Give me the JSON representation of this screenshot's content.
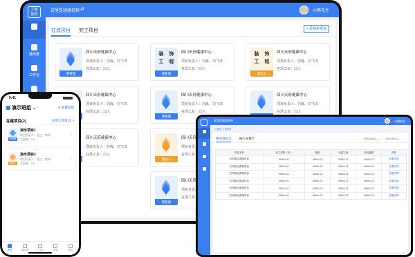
{
  "colors": {
    "primary": "#3a7ef0",
    "accent_orange": "#f0a030",
    "bg": "#f0f2f6"
  },
  "tablet": {
    "logo": "工地\n协同",
    "nav": [
      {
        "icon": "grid-icon",
        "label": ""
      },
      {
        "icon": "contacts-icon",
        "label": "通讯录"
      },
      {
        "icon": "desk-icon",
        "label": "工作台"
      },
      {
        "icon": "message-icon",
        "label": "消息"
      }
    ],
    "team_name": "这里是班组名称",
    "user_name": "小熊先生",
    "tabs": [
      "在建项目",
      "完工项目"
    ],
    "add_button": "+ 添加新项目",
    "cards": [
      {
        "badge": "我管理",
        "title": "四川天府健康中心",
        "manager": "项目负责人：刘胤、刘飞洋",
        "workers": "在场工友：23人",
        "style": "blue",
        "thumb_text": ""
      },
      {
        "badge": "我管理",
        "title": "四川天府健康中心",
        "manager": "项目负责人：刘胤、刘飞洋",
        "workers": "在场工友：23人",
        "style": "plain",
        "thumb_text": "装 饰\n工 程"
      },
      {
        "badge": "我加入",
        "title": "四川天府健康中心",
        "manager": "项目负责人：刘胤、刘飞洋",
        "workers": "在场工友：23人",
        "style": "orange",
        "thumb_text": "装 饰\n工 程"
      },
      {
        "badge": "我管理",
        "title": "四川天府健康中心",
        "manager": "项目负责人：刘胤、刘飞洋",
        "workers": "在场工友：23人",
        "style": "plain",
        "thumb_text": "装 饰\n工 程"
      },
      {
        "badge": "我管理",
        "title": "四川天府健康中心",
        "manager": "项目负责人：刘胤、刘飞洋",
        "workers": "在场工友：23人",
        "style": "blue",
        "thumb_text": ""
      },
      {
        "badge": "我管理",
        "title": "四川天府健康中心",
        "manager": "项目负责人：刘胤、刘飞洋",
        "workers": "在场工友：23人",
        "style": "blue",
        "thumb_text": ""
      },
      {
        "badge": "我管理",
        "title": "四川天府健康中心",
        "manager": "项目负责人：刘胤、刘飞洋",
        "workers": "在场工友：23人",
        "style": "plain",
        "thumb_text": ""
      },
      {
        "badge": "我加入",
        "title": "四川天府健康中心",
        "manager": "项目负责人：刘胤、刘飞洋",
        "workers": "在场工友：23人",
        "style": "orange",
        "thumb_text": ""
      },
      {
        "badge": "我管理",
        "title": "四川天府健康中心",
        "manager": "项目负责人：刘胤、刘飞洋",
        "workers": "在场工友：23人",
        "style": "plain",
        "thumb_text": ""
      },
      {
        "badge": "我管理",
        "title": "四川天府健康中心",
        "manager": "项目负责人：刘胤、刘飞洋",
        "workers": "在场工友：23人",
        "style": "blue",
        "thumb_text": ""
      }
    ]
  },
  "phone": {
    "time": "9:41",
    "team": "演示班组 ⌄",
    "new_team": "⊕ 新建班组",
    "section": "在建项目(2)",
    "switch": "已完工项目(0) >",
    "cards": [
      {
        "title": "演示项目1",
        "manager": "项目负责人：张三、李四",
        "workers": "工友数：5人",
        "badge": "我管理",
        "style": "blue"
      },
      {
        "title": "演示项目2",
        "manager": "项目负责人：张三、李四",
        "workers": "工友数：5人",
        "badge": "我加入",
        "style": "orange"
      }
    ],
    "tabbar": [
      "项目",
      "通讯录",
      "工作台",
      "消息",
      "我的"
    ]
  },
  "laptop": {
    "team_name": "这里是班组名称",
    "user_name": "小熊先生",
    "crumb": "< 返回   工资统计",
    "tabs": [
      "整项目统计",
      "按人员统计"
    ],
    "date_from": "2022-08-01 ⌄",
    "date_sep": "~",
    "date_to": "2022-08-01 ⌄",
    "nav": [
      {
        "icon": "grid-icon"
      },
      {
        "icon": "contacts-icon"
      },
      {
        "icon": "desk-icon"
      },
      {
        "icon": "message-icon"
      }
    ],
    "table": {
      "headers": [
        "项目名称",
        "总工资数（元）",
        "借支",
        "已结工资",
        "未结金额",
        "操作"
      ],
      "rows": [
        [
          "天府新区健康项目",
          "98664.32",
          "98664.32",
          "98664.32",
          "98664.32",
          "查看详情"
        ],
        [
          "天府新区健康项目",
          "98664.32",
          "98664.32",
          "98664.32",
          "98664.32",
          "查看详情"
        ],
        [
          "天府新区健康项目",
          "98664.32",
          "98664.32",
          "98664.32",
          "98664.32",
          "查看详情"
        ],
        [
          "天府新区健康项目",
          "98664.32",
          "98664.32",
          "98664.32",
          "98664.32",
          "查看详情"
        ],
        [
          "天府新区健康项目",
          "98664.32",
          "98664.32",
          "98664.32",
          "98664.32",
          "查看详情"
        ],
        [
          "天府新区健康项目",
          "98664.32",
          "98664.32",
          "98664.32",
          "98664.32",
          "查看详情"
        ]
      ]
    }
  }
}
